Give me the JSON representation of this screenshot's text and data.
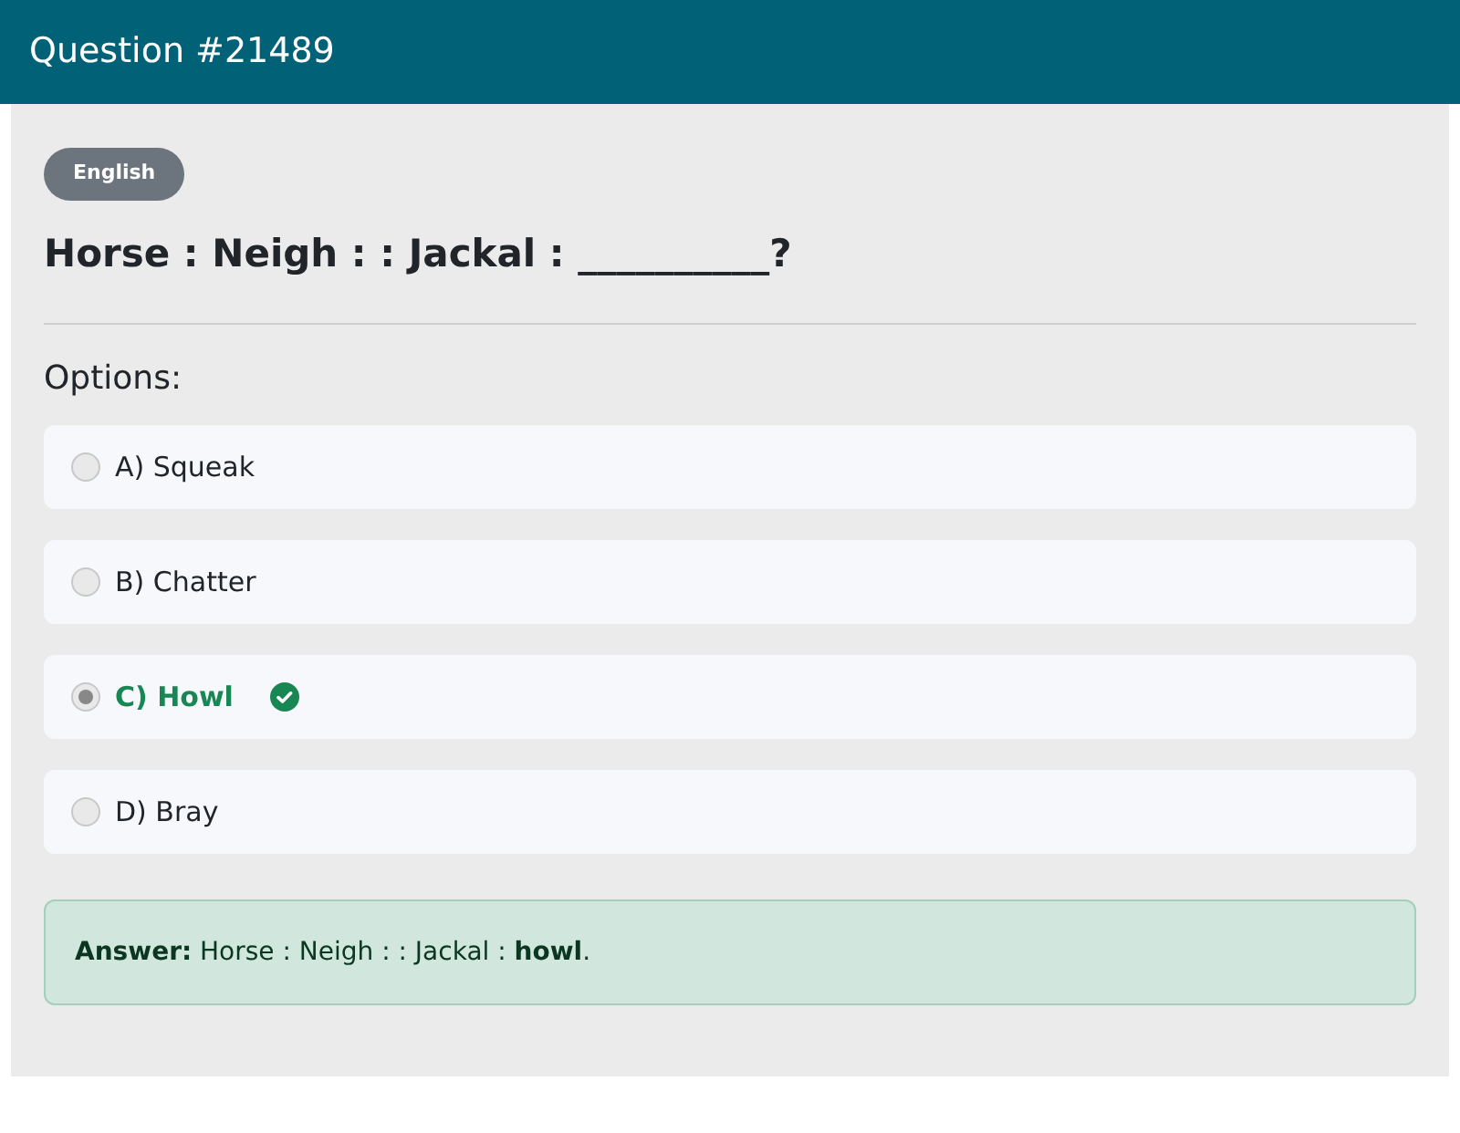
{
  "header": {
    "title": "Question #21489"
  },
  "language_badge": "English",
  "question": "Horse : Neigh : : Jackal : __________?",
  "options_label": "Options:",
  "options": [
    {
      "label": "A) Squeak",
      "selected": false,
      "correct": false
    },
    {
      "label": "B) Chatter",
      "selected": false,
      "correct": false
    },
    {
      "label": "C) Howl",
      "selected": true,
      "correct": true
    },
    {
      "label": "D) Bray",
      "selected": false,
      "correct": false
    }
  ],
  "answer": "**Answer:** Horse : Neigh : : Jackal : **howl**."
}
